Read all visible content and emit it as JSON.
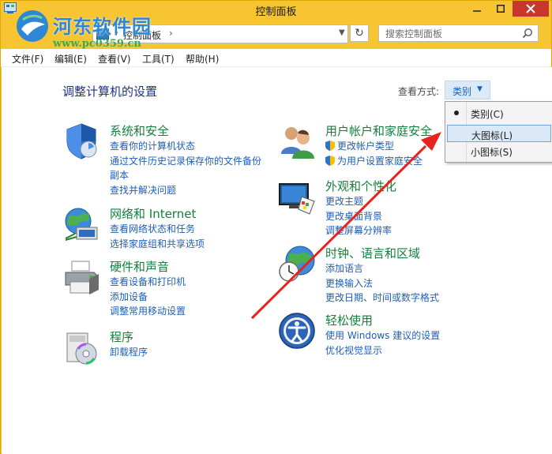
{
  "window": {
    "title": "控制面板",
    "watermark": {
      "site": "河东软件园",
      "url": "www.pc0359.cn"
    }
  },
  "address_bar": {
    "path_separator": "›",
    "current": "控制面板",
    "after": "›"
  },
  "search": {
    "placeholder": "搜索控制面板"
  },
  "menu": {
    "items": [
      {
        "label": "文件(F)"
      },
      {
        "label": "编辑(E)"
      },
      {
        "label": "查看(V)"
      },
      {
        "label": "工具(T)"
      },
      {
        "label": "帮助(H)"
      }
    ]
  },
  "main": {
    "heading": "调整计算机的设置",
    "view_by": {
      "label": "查看方式:",
      "value": "类别"
    }
  },
  "view_dropdown": {
    "options": [
      {
        "label": "类别(C)",
        "selected": true
      },
      {
        "label": "大图标(L)",
        "highlighted": true
      },
      {
        "label": "小图标(S)"
      }
    ]
  },
  "categories": {
    "system": {
      "title": "系统和安全",
      "links": [
        "查看你的计算机状态",
        "通过文件历史记录保存你的文件备份",
        "副本",
        "查找并解决问题"
      ]
    },
    "network": {
      "title": "网络和 Internet",
      "links": [
        "查看网络状态和任务",
        "选择家庭组和共享选项"
      ]
    },
    "hardware": {
      "title": "硬件和声音",
      "links": [
        "查看设备和打印机",
        "添加设备",
        "调整常用移动设置"
      ]
    },
    "programs": {
      "title": "程序",
      "links": [
        "卸载程序"
      ]
    },
    "user": {
      "title": "用户帐户和家庭安全",
      "links": [
        "更改帐户类型",
        "为用户设置家庭安全"
      ]
    },
    "appearance": {
      "title": "外观和个性化",
      "links": [
        "更改主题",
        "更改桌面背景",
        "调整屏幕分辨率"
      ]
    },
    "clock": {
      "title": "时钟、语言和区域",
      "links": [
        "添加语言",
        "更换输入法",
        "更改日期、时间或数字格式"
      ]
    },
    "ease": {
      "title": "轻松使用",
      "links": [
        "使用 Windows 建议的设置",
        "优化视觉显示"
      ]
    }
  },
  "colors": {
    "title_bar": "#f7c531",
    "category_title": "#15803d",
    "link": "#1e5eb7",
    "annotation_arrow": "#e8231c"
  },
  "icons": [
    "control-panel-icon",
    "minimize-icon",
    "maximize-icon",
    "close-icon",
    "refresh-icon",
    "search-icon",
    "shield-icon",
    "network-icon",
    "printer-icon",
    "programs-icon",
    "users-icon",
    "monitor-icon",
    "globe-clock-icon",
    "ease-of-access-icon"
  ]
}
